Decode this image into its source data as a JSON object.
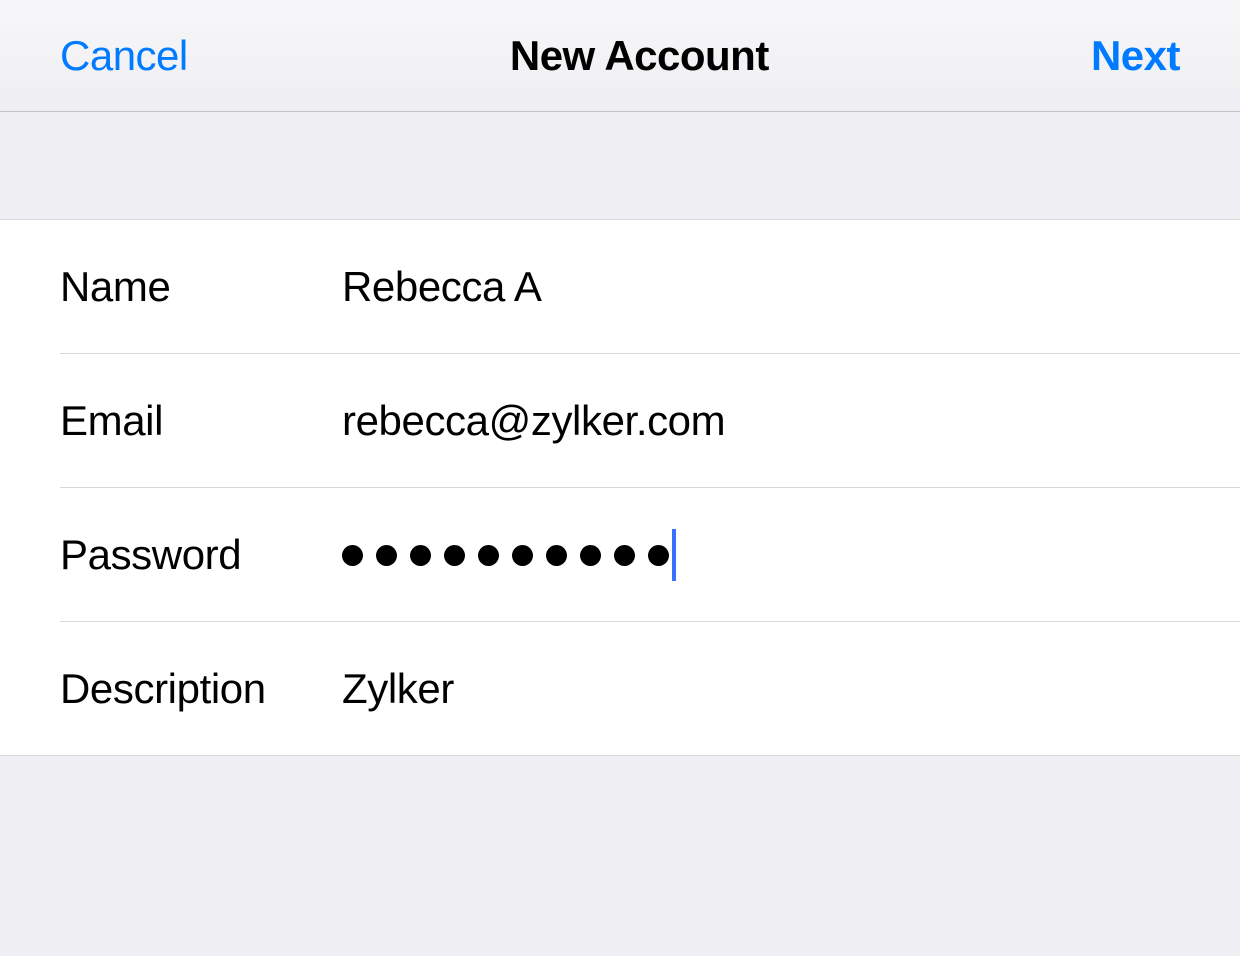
{
  "navbar": {
    "cancel_label": "Cancel",
    "title": "New Account",
    "next_label": "Next"
  },
  "form": {
    "name": {
      "label": "Name",
      "value": "Rebecca A"
    },
    "email": {
      "label": "Email",
      "value": "rebecca@zylker.com"
    },
    "password": {
      "label": "Password",
      "dot_count": 10
    },
    "description": {
      "label": "Description",
      "value": "Zylker"
    }
  }
}
